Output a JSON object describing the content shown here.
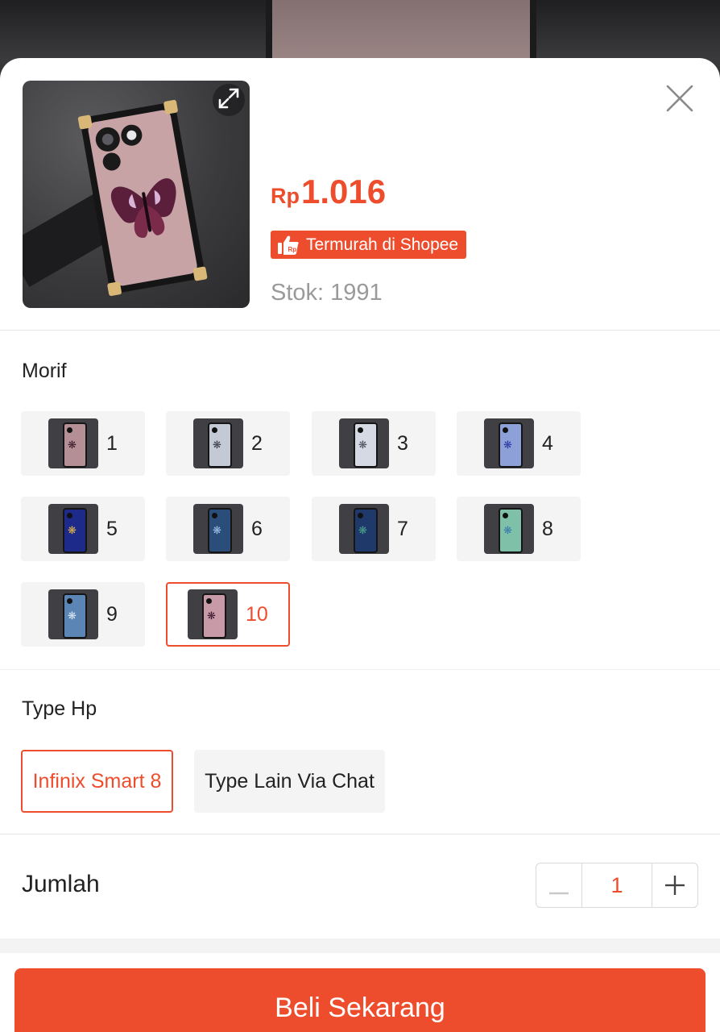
{
  "product": {
    "currency": "Rp",
    "price": "1.016",
    "badge": "Termurah di Shopee",
    "stock": "Stok: 1991"
  },
  "colors": {
    "accent": "#ee4d2d",
    "option_bg": "#f4f4f5"
  },
  "icons": {
    "expand": "expand-icon",
    "close": "close-icon",
    "badge": "thumbs-up-rp-icon",
    "minus": "minus-icon",
    "plus": "plus-icon"
  },
  "motif": {
    "title": "Morif",
    "selected": "10",
    "options": [
      {
        "label": "1",
        "case_color": "#b48f95",
        "butterfly_color": "#3a1c2a"
      },
      {
        "label": "2",
        "case_color": "#c3cad6",
        "butterfly_color": "#3a3a4a"
      },
      {
        "label": "3",
        "case_color": "#d5d9e3",
        "butterfly_color": "#4a4e5e"
      },
      {
        "label": "4",
        "case_color": "#8da0d8",
        "butterfly_color": "#2b3aa0"
      },
      {
        "label": "5",
        "case_color": "#1d2a8a",
        "butterfly_color": "#e0b84a"
      },
      {
        "label": "6",
        "case_color": "#2a4d7a",
        "butterfly_color": "#9ec0e8"
      },
      {
        "label": "7",
        "case_color": "#1f3a6a",
        "butterfly_color": "#4aa08a"
      },
      {
        "label": "8",
        "case_color": "#7fc0a8",
        "butterfly_color": "#3b7ab0"
      },
      {
        "label": "9",
        "case_color": "#5b85b5",
        "butterfly_color": "#d9e8f5"
      },
      {
        "label": "10",
        "case_color": "#c89aa8",
        "butterfly_color": "#3a1830"
      }
    ]
  },
  "type_hp": {
    "title": "Type Hp",
    "options": [
      {
        "label": "Infinix Smart 8",
        "selected": true
      },
      {
        "label": "Type Lain Via Chat",
        "selected": false
      }
    ]
  },
  "quantity": {
    "label": "Jumlah",
    "value": "1"
  },
  "buy_button": "Beli Sekarang"
}
